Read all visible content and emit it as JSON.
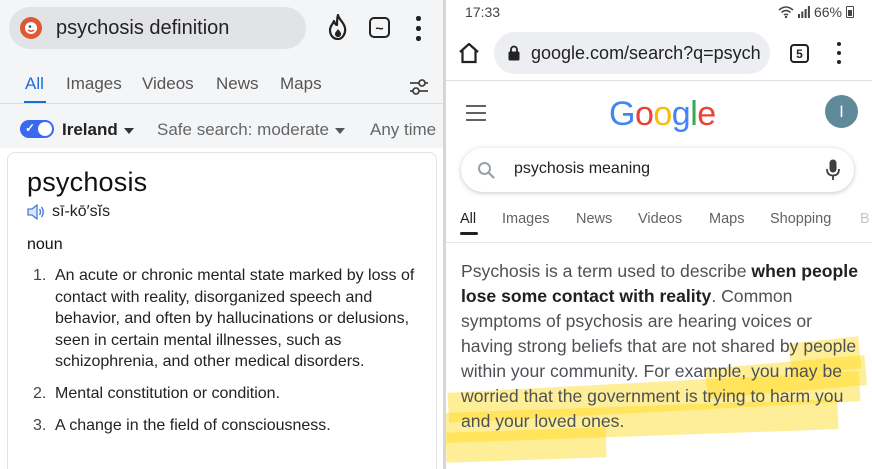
{
  "left": {
    "search": {
      "query": "psychosis definition"
    },
    "icons": {
      "logo": "duckduckgo-logo",
      "fire": "fire-icon",
      "tabs": "tabs-icon",
      "menu": "more-vert-icon",
      "filter": "filter-settings-icon"
    },
    "tabs": [
      "All",
      "Images",
      "Videos",
      "News",
      "Maps"
    ],
    "active_tab": "All",
    "filters": {
      "region": "Ireland",
      "safe_search": "Safe search: moderate",
      "time": "Any time"
    },
    "dictionary": {
      "word": "psychosis",
      "pronunciation": "sī-kō′sĭs",
      "part_of_speech": "noun",
      "definitions": [
        {
          "num": "1.",
          "text": "An acute or chronic mental state marked by loss of contact with reality, disorganized speech and behavior, and often by hallucinations or delusions, seen in certain mental illnesses, such as schizophrenia, and other medical disorders."
        },
        {
          "num": "2.",
          "text": "Mental constitution or condition."
        },
        {
          "num": "3.",
          "text": "A change in the field of consciousness."
        }
      ]
    }
  },
  "right": {
    "status": {
      "time": "17:33",
      "battery": "66%"
    },
    "browser": {
      "url": "google.com/search?q=psych",
      "tab_count": "5"
    },
    "google": {
      "logo_letters": [
        {
          "ch": "G",
          "color": "#4285F4"
        },
        {
          "ch": "o",
          "color": "#EA4335"
        },
        {
          "ch": "o",
          "color": "#FBBC05"
        },
        {
          "ch": "g",
          "color": "#4285F4"
        },
        {
          "ch": "l",
          "color": "#34A853"
        },
        {
          "ch": "e",
          "color": "#EA4335"
        }
      ],
      "avatar_initial": "I",
      "search_query": "psychosis meaning",
      "tabs": [
        "All",
        "Images",
        "News",
        "Videos",
        "Maps",
        "Shopping",
        "B"
      ],
      "active_tab": "All",
      "snippet": {
        "part1": "Psychosis is a term used to describe ",
        "bold": "when people lose some contact with reality",
        "part2": ". Common symptoms of psychosis are hearing voices or having strong beliefs that are not shared by people within your community. For example, you may be worried that the government is trying to harm you and your loved ones."
      }
    },
    "highlight_color": "#FFD60A"
  }
}
